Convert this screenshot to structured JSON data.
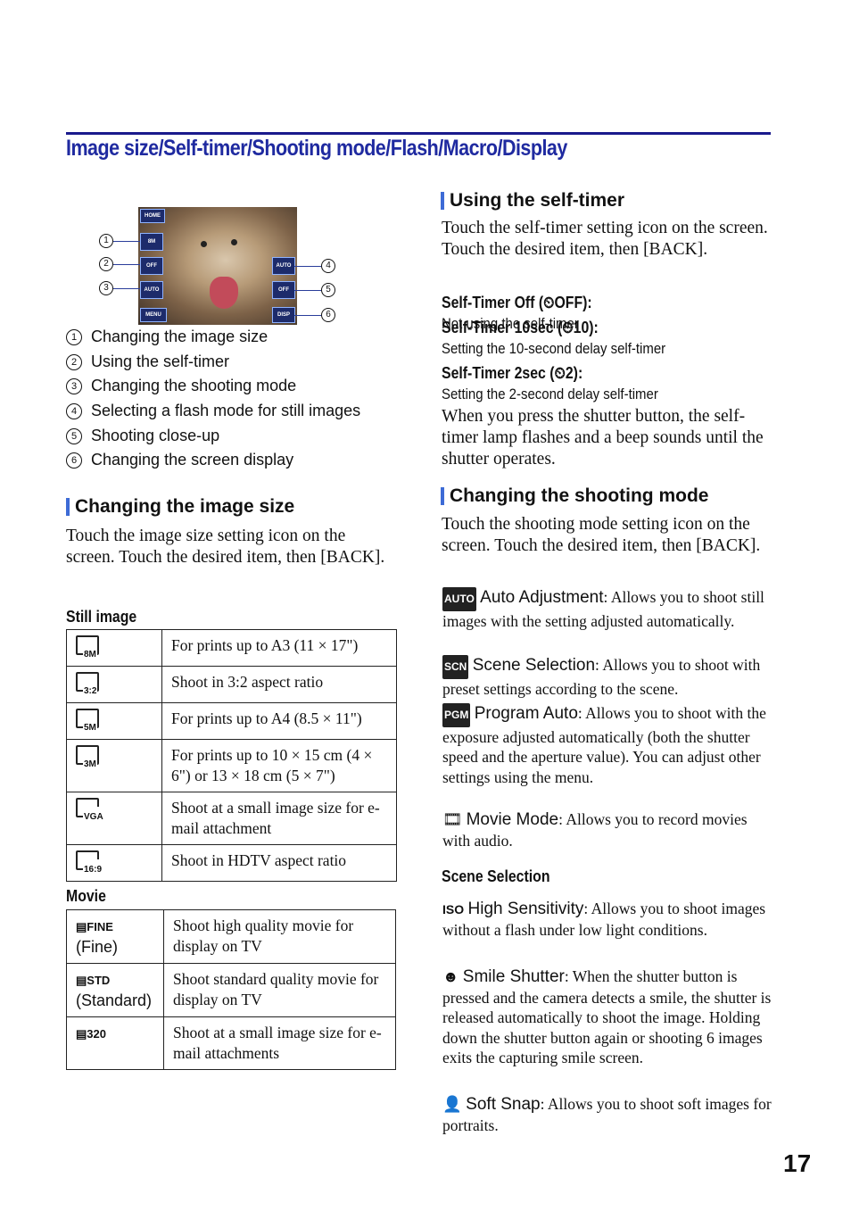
{
  "page_title": "Image size/Self-timer/Shooting mode/Flash/Macro/Display",
  "page_number": "17",
  "camera_screen": {
    "top_buttons": [
      "HOME"
    ],
    "left_buttons": [
      "8M",
      "OFF",
      "AUTO",
      "MENU"
    ],
    "right_buttons": [
      "AUTO",
      "OFF",
      "DISP"
    ]
  },
  "callouts": [
    "1",
    "2",
    "3",
    "4",
    "5",
    "6"
  ],
  "legend": [
    {
      "num": "1",
      "label": "Changing the image size"
    },
    {
      "num": "2",
      "label": "Using the self-timer"
    },
    {
      "num": "3",
      "label": "Changing the shooting mode"
    },
    {
      "num": "4",
      "label": "Selecting a flash mode for still images"
    },
    {
      "num": "5",
      "label": "Shooting close-up"
    },
    {
      "num": "6",
      "label": "Changing the screen display"
    }
  ],
  "image_size": {
    "heading": "Changing the image size",
    "intro": "Touch the image size setting icon on the screen. Touch the desired item, then [BACK].",
    "still_heading": "Still image",
    "still_rows": [
      {
        "icon": "8M",
        "desc": "For prints up to A3 (11 × 17\")"
      },
      {
        "icon": "3:2",
        "desc": "Shoot in 3:2 aspect ratio"
      },
      {
        "icon": "5M",
        "desc": "For prints up to A4 (8.5 × 11\")"
      },
      {
        "icon": "3M",
        "desc": "For prints up to 10 × 15 cm (4 × 6\") or 13 × 18 cm (5 × 7\")"
      },
      {
        "icon": "VGA",
        "desc": "Shoot at a small image size for e-mail attachment"
      },
      {
        "icon": "16:9",
        "desc": "Shoot in HDTV aspect ratio"
      }
    ],
    "movie_heading": "Movie",
    "movie_rows": [
      {
        "icon": "FINE",
        "sub": "(Fine)",
        "desc": "Shoot high quality movie for display on TV"
      },
      {
        "icon": "STD",
        "sub": "(Standard)",
        "desc": "Shoot standard quality movie for display on TV"
      },
      {
        "icon": "320",
        "sub": "",
        "desc": "Shoot at a small image size for e-mail attachments"
      }
    ]
  },
  "self_timer": {
    "heading": "Using the self-timer",
    "intro": "Touch the self-timer setting icon on the screen. Touch the desired item, then [BACK].",
    "items": [
      {
        "term": "Self-Timer Off (",
        "icon": "⏲OFF",
        "close": "):",
        "desc": "Not using the self-timer"
      },
      {
        "term": "Self-Timer 10sec (",
        "icon": "⏲10",
        "close": "):",
        "desc": "Setting the 10-second delay self-timer"
      },
      {
        "term": "Self-Timer 2sec (",
        "icon": "⏲2",
        "close": "):",
        "desc": "Setting the 2-second delay self-timer"
      }
    ],
    "note": "When you press the shutter button, the self-timer lamp flashes and a beep sounds until the shutter operates."
  },
  "shooting_mode": {
    "heading": "Changing the shooting mode",
    "intro": "Touch the shooting mode setting icon on the screen. Touch the desired item, then [BACK].",
    "modes": [
      {
        "icon": "AUTO",
        "term": "Auto Adjustment",
        "desc": "Allows you to shoot still images with the setting adjusted automatically."
      },
      {
        "icon": "SCN",
        "term": "Scene Selection",
        "desc": "Allows you to shoot with preset settings according to the scene."
      },
      {
        "icon": "PGM",
        "term": "Program Auto",
        "desc": "Allows you to shoot with the exposure adjusted automatically (both the shutter speed and the aperture value). You can adjust other settings using the menu."
      },
      {
        "icon": "🎞",
        "term": "Movie Mode",
        "desc": "Allows you to record movies with audio."
      }
    ],
    "scene_heading": "Scene Selection",
    "scenes": [
      {
        "icon": "ISO",
        "term": "High Sensitivity",
        "desc": "Allows you to shoot images without a flash under low light conditions."
      },
      {
        "icon": "☻",
        "term": "Smile Shutter",
        "desc": "When the shutter button is pressed and the camera detects a smile, the shutter is released automatically to shoot the image. Holding down the shutter button again or shooting 6 images exits the capturing smile screen."
      },
      {
        "icon": "👤",
        "term": "Soft Snap",
        "desc": "Allows you to shoot soft images for portraits."
      }
    ]
  }
}
